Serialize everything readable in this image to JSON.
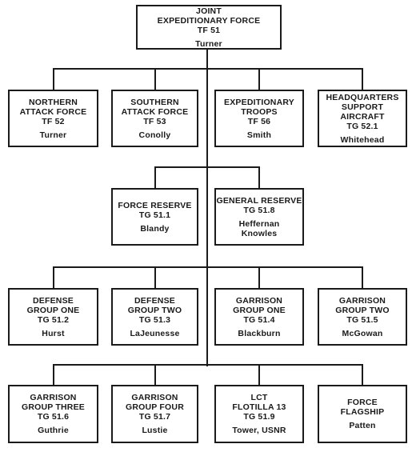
{
  "diagram": {
    "type": "organization-chart",
    "root": {
      "id": "tf51",
      "title_lines": [
        "JOINT",
        "EXPEDITIONARY FORCE"
      ],
      "code": "TF 51",
      "commander_lines": [
        "Turner"
      ]
    },
    "rows": [
      {
        "nodes": [
          {
            "id": "tf52",
            "title_lines": [
              "NORTHERN",
              "ATTACK FORCE"
            ],
            "code": "TF 52",
            "commander_lines": [
              "Turner"
            ]
          },
          {
            "id": "tf53",
            "title_lines": [
              "SOUTHERN",
              "ATTACK FORCE"
            ],
            "code": "TF 53",
            "commander_lines": [
              "Conolly"
            ]
          },
          {
            "id": "tf56",
            "title_lines": [
              "EXPEDITIONARY",
              "TROOPS"
            ],
            "code": "TF 56",
            "commander_lines": [
              "Smith"
            ]
          },
          {
            "id": "tg521",
            "title_lines": [
              "HEADQUARTERS",
              "SUPPORT AIRCRAFT"
            ],
            "code": "TG 52.1",
            "commander_lines": [
              "Whitehead"
            ]
          }
        ]
      },
      {
        "nodes": [
          {
            "id": "tg511",
            "title_lines": [
              "FORCE RESERVE"
            ],
            "code": "TG 51.1",
            "commander_lines": [
              "Blandy"
            ]
          },
          {
            "id": "tg518",
            "title_lines": [
              "GENERAL RESERVE"
            ],
            "code": "TG 51.8",
            "commander_lines": [
              "Heffernan",
              "Knowles"
            ]
          }
        ]
      },
      {
        "nodes": [
          {
            "id": "tg512",
            "title_lines": [
              "DEFENSE",
              "GROUP ONE"
            ],
            "code": "TG 51.2",
            "commander_lines": [
              "Hurst"
            ]
          },
          {
            "id": "tg513",
            "title_lines": [
              "DEFENSE",
              "GROUP TWO"
            ],
            "code": "TG 51.3",
            "commander_lines": [
              "LaJeunesse"
            ]
          },
          {
            "id": "tg514",
            "title_lines": [
              "GARRISON",
              "GROUP ONE"
            ],
            "code": "TG 51.4",
            "commander_lines": [
              "Blackburn"
            ]
          },
          {
            "id": "tg515",
            "title_lines": [
              "GARRISON",
              "GROUP TWO"
            ],
            "code": "TG 51.5",
            "commander_lines": [
              "McGowan"
            ]
          }
        ]
      },
      {
        "nodes": [
          {
            "id": "tg516",
            "title_lines": [
              "GARRISON",
              "GROUP THREE"
            ],
            "code": "TG 51.6",
            "commander_lines": [
              "Guthrie"
            ]
          },
          {
            "id": "tg517",
            "title_lines": [
              "GARRISON",
              "GROUP FOUR"
            ],
            "code": "TG 51.7",
            "commander_lines": [
              "Lustie"
            ]
          },
          {
            "id": "tg519",
            "title_lines": [
              "LCT",
              "FLOTILLA 13"
            ],
            "code": "TG 51.9",
            "commander_lines": [
              "Tower, USNR"
            ]
          },
          {
            "id": "flagship",
            "title_lines": [
              "FORCE",
              "FLAGSHIP"
            ],
            "code": "",
            "commander_lines": [
              "Patten"
            ]
          }
        ]
      }
    ]
  }
}
